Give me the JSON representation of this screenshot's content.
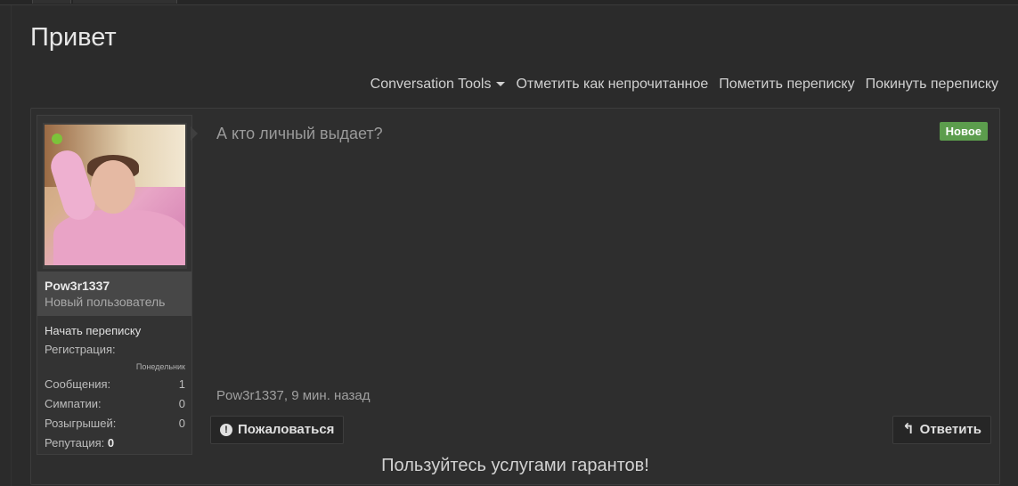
{
  "page": {
    "title": "Привет"
  },
  "tools": {
    "conversation_tools": "Conversation Tools",
    "mark_unread": "Отметить как непрочитанное",
    "mark_conversation": "Пометить переписку",
    "leave_conversation": "Покинуть переписку"
  },
  "user": {
    "name": "Pow3r1337",
    "title": "Новый пользователь",
    "start_conversation": "Начать переписку",
    "registration_label": "Регистрация:",
    "registration_value": "Понедельник",
    "messages_label": "Сообщения:",
    "messages_value": "1",
    "likes_label": "Симпатии:",
    "likes_value": "0",
    "giveaways_label": "Розыгрышей:",
    "giveaways_value": "0",
    "reputation_label": "Репутация:",
    "reputation_value": "0",
    "online_status_color": "#7cc33a"
  },
  "message": {
    "text": "А кто личный выдает?",
    "badge": "Новое",
    "meta": "Pow3r1337, 9 мин. назад",
    "report_label": "Пожаловаться",
    "reply_label": "Ответить"
  },
  "footer": {
    "note": "Пользуйтесь услугами гарантов!"
  },
  "icons": {
    "report": "alert-circle-icon",
    "reply": "reply-arrow-icon",
    "dropdown": "caret-down-icon"
  },
  "colors": {
    "badge_new": "#5c9d4d",
    "background": "#2b2b2b"
  }
}
